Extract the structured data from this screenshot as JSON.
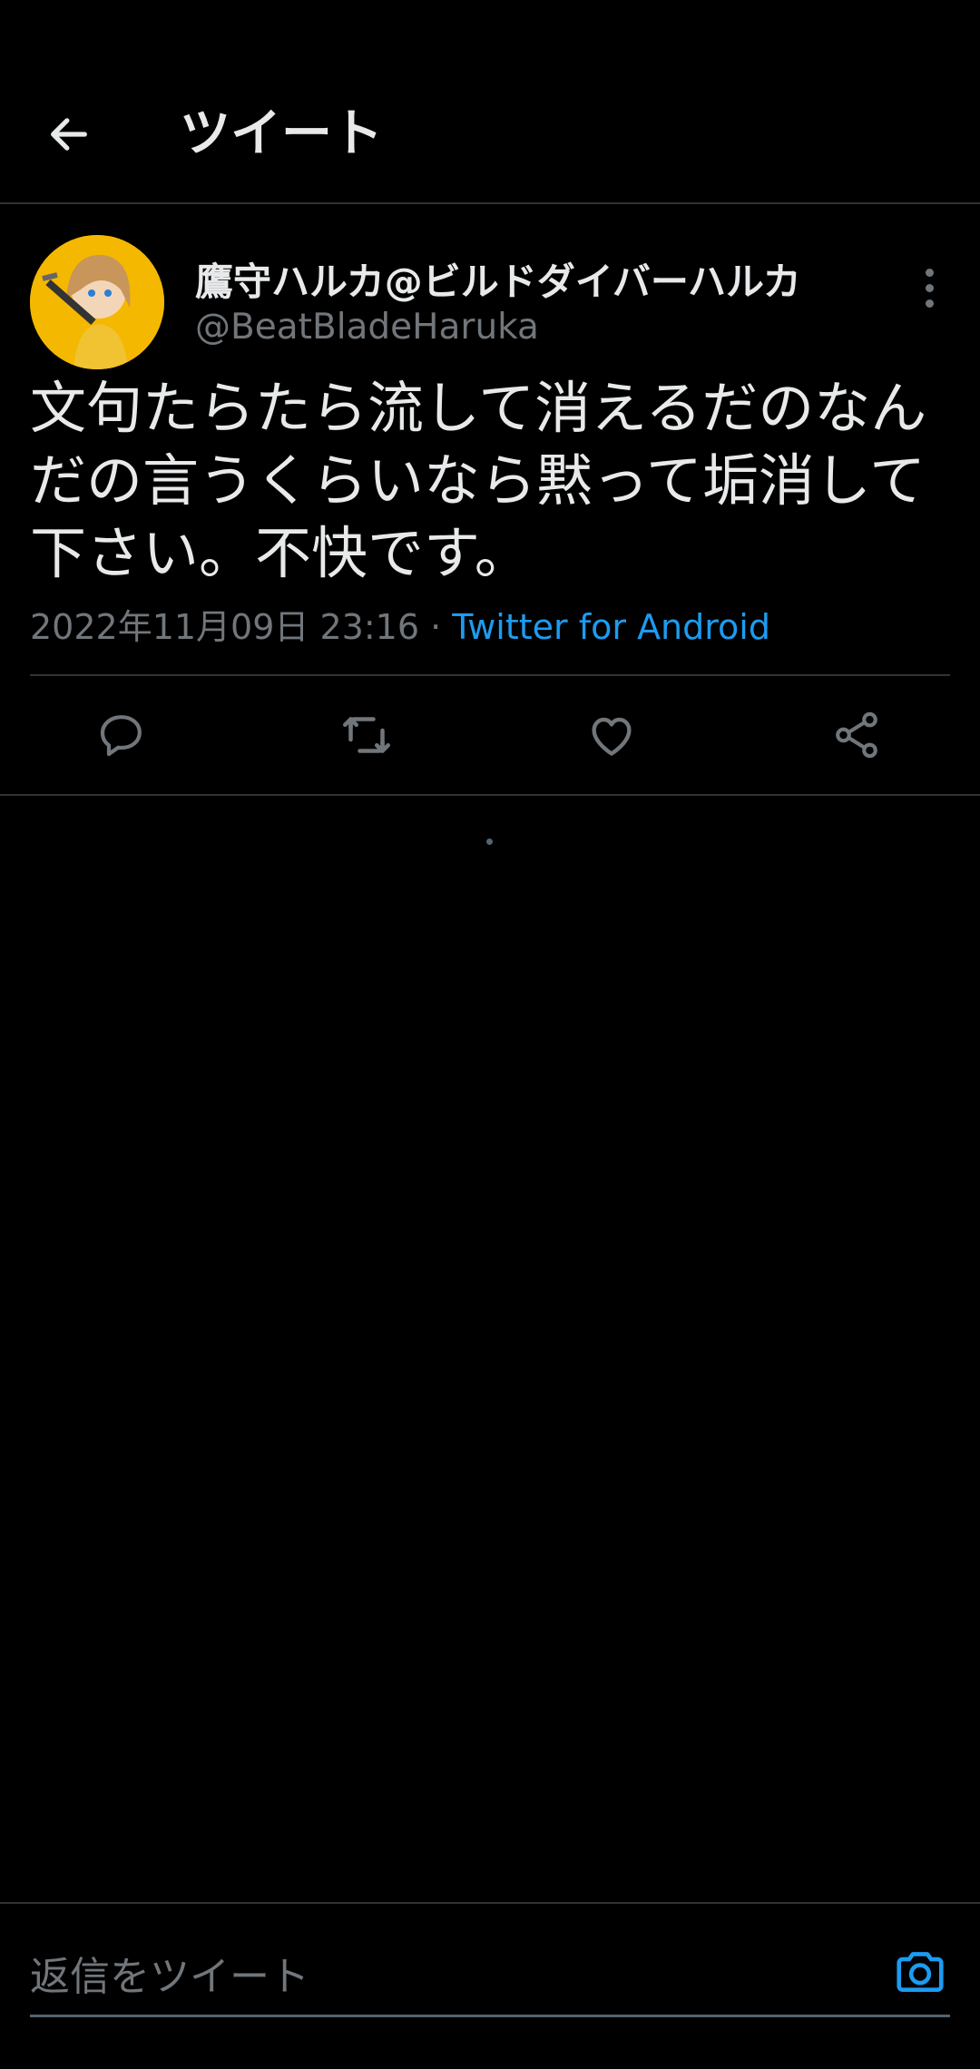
{
  "header": {
    "title": "ツイート",
    "back_icon": "arrow-left-icon"
  },
  "tweet": {
    "display_name": "鷹守ハルカ@ビルドダイバーハルカ",
    "handle": "@BeatBladeHaruka",
    "text": "文句たらたら流して消えるだのなんだの言うくらいなら黙って垢消して下さい。不快です。",
    "timestamp": "2022年11月09日 23:16",
    "separator": "·",
    "source": "Twitter for Android",
    "actions": [
      "reply-icon",
      "retweet-icon",
      "like-icon",
      "share-icon"
    ]
  },
  "reply_bar": {
    "placeholder": "返信をツイート",
    "camera_icon": "camera-icon"
  },
  "colors": {
    "background": "#000000",
    "text_primary": "#e7e9ea",
    "text_secondary": "#71767b",
    "accent": "#1d9bf0",
    "divider": "#2f3336"
  }
}
